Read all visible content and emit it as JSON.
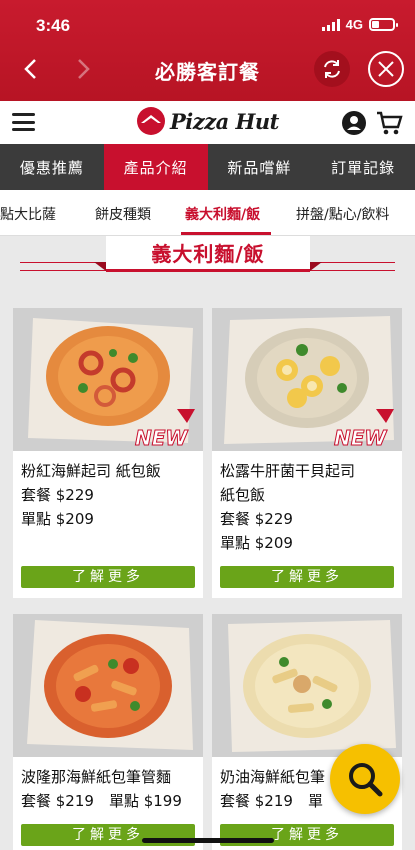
{
  "status": {
    "time": "3:46",
    "network": "4G"
  },
  "header": {
    "title": "必勝客訂餐"
  },
  "brand": {
    "logo_text": "Pizza Hut"
  },
  "main_tabs": [
    {
      "label": "優惠推薦"
    },
    {
      "label": "產品介紹",
      "active": true
    },
    {
      "label": "新品嚐鮮"
    },
    {
      "label": "訂單記錄"
    }
  ],
  "sub_tabs": [
    {
      "label": "餐點大比薩"
    },
    {
      "label": "餅皮種類"
    },
    {
      "label": "義大利麵/飯",
      "active": true
    },
    {
      "label": "拼盤/點心/飲料"
    }
  ],
  "section": {
    "title": "義大利麵/飯"
  },
  "products": [
    {
      "name": "粉紅海鮮起司 紙包飯",
      "set_price": "套餐 $229",
      "single_price": "單點 $209",
      "button": "了解更多",
      "badge": "NEW"
    },
    {
      "name_line1": "松露牛肝菌干貝起司",
      "name_line2": "紙包飯",
      "set_price": "套餐 $229",
      "single_price": "單點 $209",
      "button": "了解更多",
      "badge": "NEW"
    },
    {
      "name": "波隆那海鮮紙包筆管麵",
      "price_line": "套餐 $219　單點 $199",
      "button": "了解更多"
    },
    {
      "name": "奶油海鮮紙包筆",
      "price_line": "套餐 $219　單",
      "button": "了解更多"
    }
  ],
  "colors": {
    "brand_red": "#c8102e",
    "button_green": "#6aa419",
    "fab_yellow": "#f6c000",
    "tab_dark": "#3b3b3b"
  }
}
